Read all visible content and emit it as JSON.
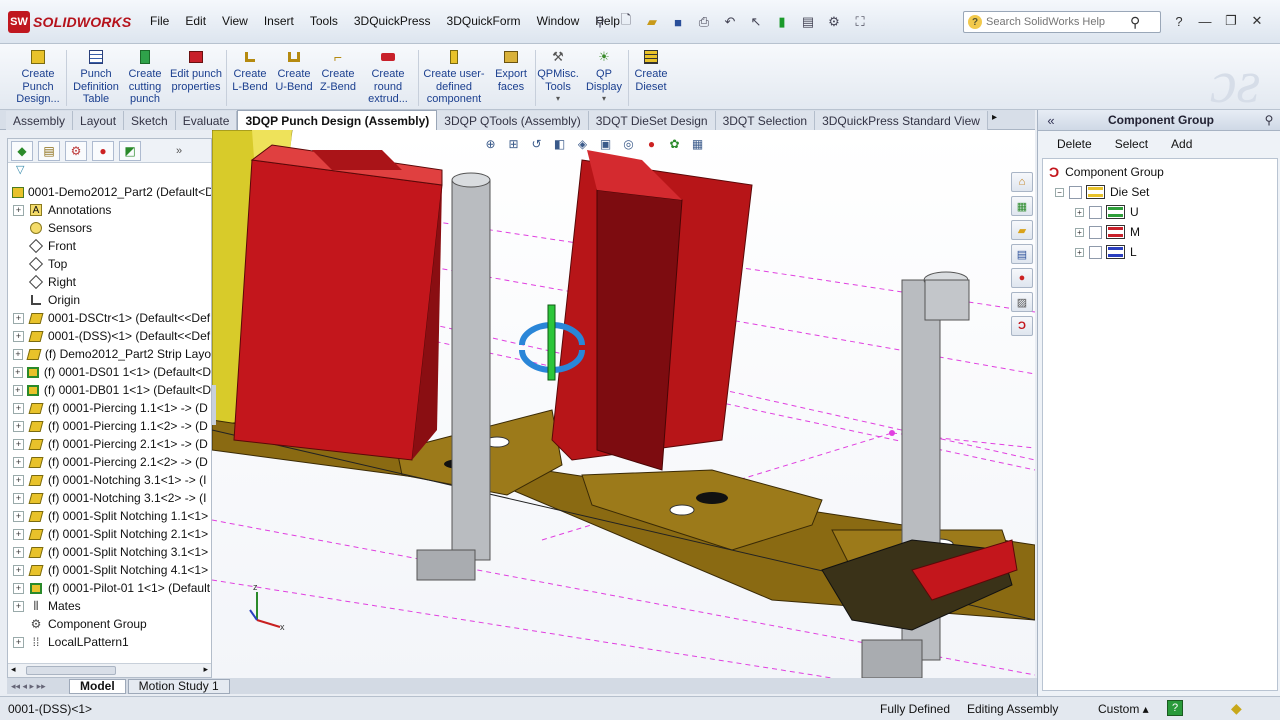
{
  "app": {
    "brand": "SOLIDWORKS",
    "brand_prefix": "SW"
  },
  "menu": [
    "File",
    "Edit",
    "View",
    "Insert",
    "Tools",
    "3DQuickPress",
    "3DQuickForm",
    "Window",
    "Help"
  ],
  "help_search": {
    "placeholder": "Search SolidWorks Help"
  },
  "ribbon": {
    "buttons": [
      {
        "label": "Create Punch Design...",
        "icon": "punch-design-icon"
      },
      {
        "label": "Punch Definition Table",
        "icon": "table-icon"
      },
      {
        "label": "Create cutting punch",
        "icon": "cutting-punch-icon"
      },
      {
        "label": "Edit punch properties",
        "icon": "edit-punch-icon"
      },
      {
        "label": "Create L-Bend",
        "icon": "l-bend-icon"
      },
      {
        "label": "Create U-Bend",
        "icon": "u-bend-icon"
      },
      {
        "label": "Create Z-Bend",
        "icon": "z-bend-icon"
      },
      {
        "label": "Create round extrud...",
        "icon": "round-extrude-icon"
      },
      {
        "label": "Create user-defined component",
        "icon": "user-component-icon"
      },
      {
        "label": "Export faces",
        "icon": "export-faces-icon"
      },
      {
        "label": "QPMisc. Tools",
        "icon": "misc-tools-icon"
      },
      {
        "label": "QP Display",
        "icon": "display-icon"
      },
      {
        "label": "Create Dieset",
        "icon": "dieset-icon"
      }
    ]
  },
  "tabs": [
    "Assembly",
    "Layout",
    "Sketch",
    "Evaluate",
    "3DQP Punch Design (Assembly)",
    "3DQP QTools (Assembly)",
    "3DQT DieSet Design",
    "3DQT Selection",
    "3DQuickPress Standard View"
  ],
  "active_tab": "3DQP Punch Design (Assembly)",
  "tree": {
    "filter": "▽",
    "root": "0001-Demo2012_Part2  (Default<D",
    "items": [
      {
        "label": "Annotations",
        "expand": "+",
        "icon": "annotations-icon"
      },
      {
        "label": "Sensors",
        "expand": "",
        "icon": "sensors-icon"
      },
      {
        "label": "Front",
        "expand": "",
        "icon": "plane-icon"
      },
      {
        "label": "Top",
        "expand": "",
        "icon": "plane-icon"
      },
      {
        "label": "Right",
        "expand": "",
        "icon": "plane-icon"
      },
      {
        "label": "Origin",
        "expand": "",
        "icon": "origin-icon"
      },
      {
        "label": "0001-DSCtr<1> (Default<<Def",
        "expand": "+",
        "icon": "part-icon"
      },
      {
        "label": "0001-(DSS)<1> (Default<<Def",
        "expand": "+",
        "icon": "part-icon"
      },
      {
        "label": "(f) Demo2012_Part2 Strip Layo",
        "expand": "+",
        "icon": "part-icon"
      },
      {
        "label": "(f) 0001-DS01 1<1> (Default<D",
        "expand": "+",
        "icon": "assembly-icon"
      },
      {
        "label": "(f) 0001-DB01 1<1> (Default<D",
        "expand": "+",
        "icon": "assembly-icon"
      },
      {
        "label": "(f) 0001-Piercing 1.1<1> -> (D",
        "expand": "+",
        "icon": "part-icon"
      },
      {
        "label": "(f) 0001-Piercing 1.1<2> -> (D",
        "expand": "+",
        "icon": "part-icon"
      },
      {
        "label": "(f) 0001-Piercing 2.1<1> -> (D",
        "expand": "+",
        "icon": "part-icon"
      },
      {
        "label": "(f) 0001-Piercing 2.1<2> -> (D",
        "expand": "+",
        "icon": "part-icon"
      },
      {
        "label": "(f) 0001-Notching 3.1<1> -> (I",
        "expand": "+",
        "icon": "part-icon"
      },
      {
        "label": "(f) 0001-Notching 3.1<2> -> (I",
        "expand": "+",
        "icon": "part-icon"
      },
      {
        "label": "(f) 0001-Split Notching 1.1<1>",
        "expand": "+",
        "icon": "part-icon"
      },
      {
        "label": "(f) 0001-Split Notching 2.1<1>",
        "expand": "+",
        "icon": "part-icon"
      },
      {
        "label": "(f) 0001-Split Notching 3.1<1>",
        "expand": "+",
        "icon": "part-icon"
      },
      {
        "label": "(f) 0001-Split Notching 4.1<1>",
        "expand": "+",
        "icon": "part-icon"
      },
      {
        "label": "(f) 0001-Pilot-01 1<1> (Default",
        "expand": "+",
        "icon": "assembly-icon"
      },
      {
        "label": "Mates",
        "expand": "+",
        "icon": "mates-icon"
      },
      {
        "label": "Component Group",
        "expand": "",
        "icon": "component-group-icon"
      },
      {
        "label": "LocalLPattern1",
        "expand": "+",
        "icon": "pattern-icon"
      }
    ]
  },
  "model_tabs": [
    "Model",
    "Motion Study 1"
  ],
  "status": {
    "selection": "0001-(DSS)<1>",
    "definition": "Fully Defined",
    "mode": "Editing Assembly",
    "units": "Custom ▴"
  },
  "component_group": {
    "title": "Component Group",
    "actions": [
      "Delete",
      "Select",
      "Add"
    ],
    "root": "Component Group",
    "dieset": "Die Set",
    "children": [
      "U",
      "M",
      "L"
    ],
    "child_colors": [
      "#2e9e3a",
      "#c8202a",
      "#2a3fbf"
    ]
  },
  "triad": {
    "x": "x",
    "z": "z"
  },
  "colors": {
    "accent": "#1b3f8f",
    "punch_red": "#c3161c",
    "strip": "#8a6a12",
    "pillar": "#b9bcc0"
  }
}
